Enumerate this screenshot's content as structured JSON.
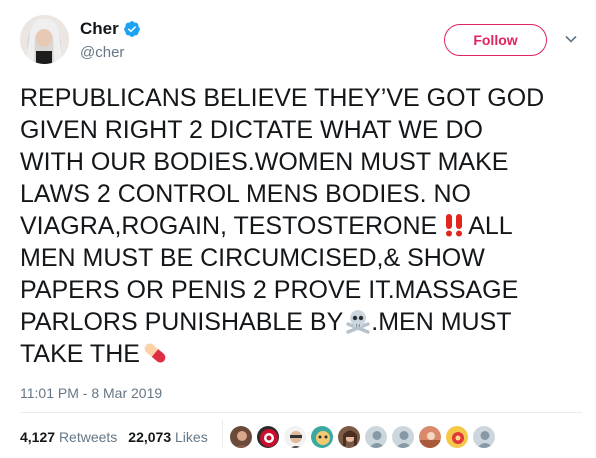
{
  "user": {
    "display_name": "Cher",
    "handle": "@cher",
    "verified": true,
    "avatar_icon": "profile-photo"
  },
  "actions": {
    "follow_label": "Follow",
    "follow_color": "#e0245e",
    "more_icon": "chevron-down-icon"
  },
  "tweet": {
    "lines": [
      "REPUBLICANS BELIEVE THEY’VE GOT GOD",
      "GIVEN RIGHT 2 DICTATE WHAT WE DO",
      "WITH OUR BODIES.WOMEN MUST MAKE",
      "LAWS 2 CONTROL MENS BODIES. NO",
      "VIAGRA,ROGAIN, TESTOSTERONE",
      "ALL",
      "MEN MUST BE CIRCUMCISED,& SHOW",
      "PAPERS OR PENIS 2 PROVE IT.MASSAGE",
      "PARLORS PUNISHABLE BY",
      ".MEN MUST",
      "TAKE THE"
    ],
    "emojis": [
      "double-exclamation-icon",
      "skull-crossbones-icon",
      "pill-icon"
    ]
  },
  "timestamp": "11:01 PM - 8 Mar 2019",
  "stats": {
    "retweets_count": "4,127",
    "retweets_label": "Retweets",
    "likes_count": "22,073",
    "likes_label": "Likes"
  },
  "likers_count_shown": 10,
  "colors": {
    "text": "#14171a",
    "secondary": "#657786",
    "verified": "#1da1f2",
    "divider": "#e6ecf0"
  }
}
